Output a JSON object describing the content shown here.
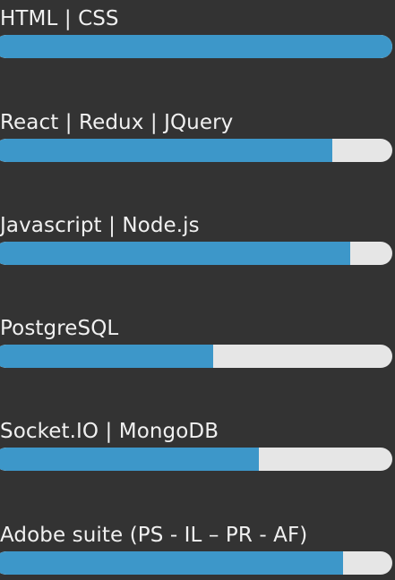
{
  "colors": {
    "background": "#333333",
    "text": "#f0f0f0",
    "bar_fill": "#3d97c9",
    "bar_track": "#e6e6e6"
  },
  "skills": [
    {
      "label": "HTML | CSS",
      "level": 1.0
    },
    {
      "label": "React | Redux | JQuery",
      "level": 0.85
    },
    {
      "label": "Javascript | Node.js",
      "level": 0.895
    },
    {
      "label": "PostgreSQL",
      "level": 0.55
    },
    {
      "label": "Socket.IO | MongoDB",
      "level": 0.665
    },
    {
      "label": "Adobe suite (PS - IL – PR - AF)",
      "level": 0.875
    }
  ]
}
